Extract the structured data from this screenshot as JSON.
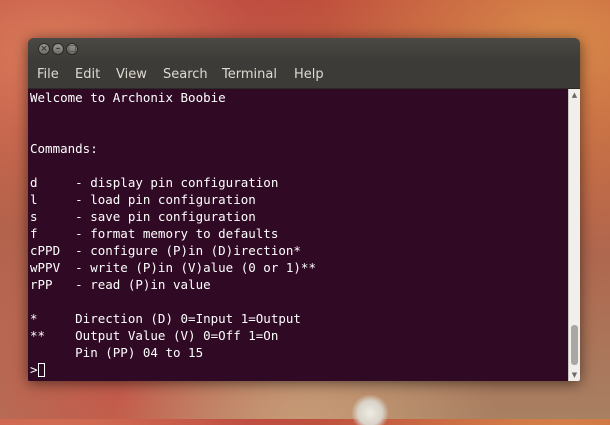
{
  "window": {
    "buttons": {
      "close": "×",
      "minimize": "–",
      "maximize": "□"
    }
  },
  "menu": [
    "File",
    "Edit",
    "View",
    "Search",
    "Terminal",
    "Help"
  ],
  "terminal": {
    "lines": [
      "Welcome to Archonix Boobie",
      "",
      "",
      "Commands:",
      "",
      "d     - display pin configuration",
      "l     - load pin configuration",
      "s     - save pin configuration",
      "f     - format memory to defaults",
      "cPPD  - configure (P)in (D)irection*",
      "wPPV  - write (P)in (V)alue (0 or 1)**",
      "rPP   - read (P)in value",
      "",
      "*     Direction (D) 0=Input 1=Output",
      "**    Output Value (V) 0=Off 1=On",
      "      Pin (PP) 04 to 15",
      ""
    ],
    "prompt": ">",
    "colors": {
      "background": "#300a24",
      "foreground": "#ffffff"
    }
  },
  "scrollbar": {
    "up": "▲",
    "down": "▼"
  }
}
